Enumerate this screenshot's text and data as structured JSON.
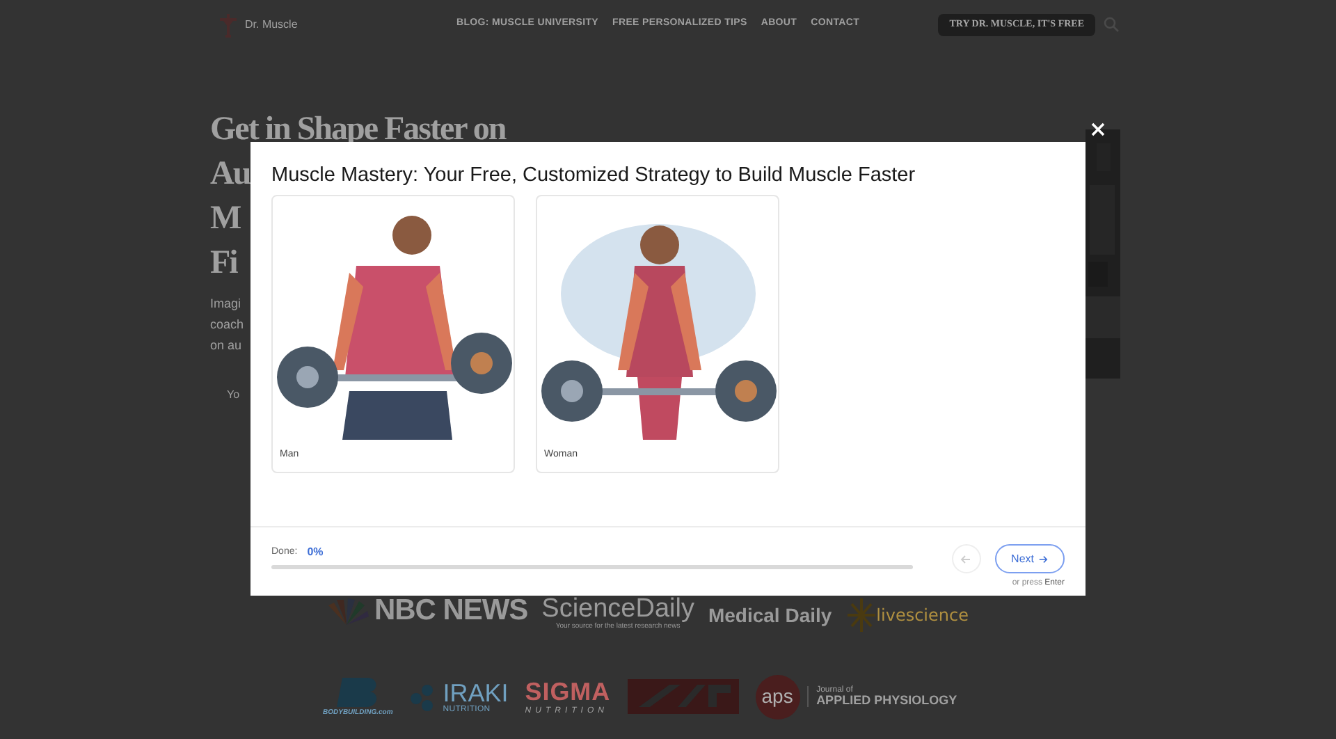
{
  "header": {
    "logo_text": "Dr. Muscle",
    "nav": [
      "BLOG: MUSCLE UNIVERSITY",
      "FREE PERSONALIZED TIPS",
      "ABOUT",
      "CONTACT"
    ],
    "cta": "TRY DR. MUSCLE, IT'S FREE"
  },
  "hero": {
    "title_lines": [
      "Get in Shape Faster on",
      "Au",
      "M",
      "Fi"
    ],
    "body_lines": [
      "Imagi",
      "coach",
      "on au"
    ],
    "note": "Yo"
  },
  "press": {
    "row_1": [
      {
        "kind": "nbc",
        "text": "NBC NEWS"
      },
      {
        "kind": "sciencedaily",
        "text": "ScienceDaily",
        "sub": "Your source for the latest research news"
      },
      {
        "kind": "plain",
        "text": "Medical Daily"
      },
      {
        "kind": "livescience",
        "text": "livescience"
      }
    ],
    "row_2": [
      {
        "kind": "bodybuilding",
        "text": "BODYBUILDING.com"
      },
      {
        "kind": "iraki",
        "text": "IRAKI",
        "sub": "NUTRITION"
      },
      {
        "kind": "sigma",
        "text": "SIGMA",
        "sub": "NUTRITION"
      },
      {
        "kind": "xrr"
      },
      {
        "kind": "aps",
        "text": "aps",
        "sub": "Journal of",
        "sub2": "APPLIED PHYSIOLOGY"
      }
    ]
  },
  "modal": {
    "title": "Muscle Mastery: Your Free, Customized Strategy to Build Muscle Faster",
    "options": [
      {
        "label": "Man",
        "selected": false,
        "kind": "picture"
      },
      {
        "label": "Woman",
        "selected": false,
        "kind": "picture"
      }
    ],
    "progress": {
      "label": "Done:",
      "value": "0%",
      "level": 0
    },
    "back_disabled": true,
    "next": "Next",
    "hint": "or press",
    "hint_key": "Enter"
  }
}
